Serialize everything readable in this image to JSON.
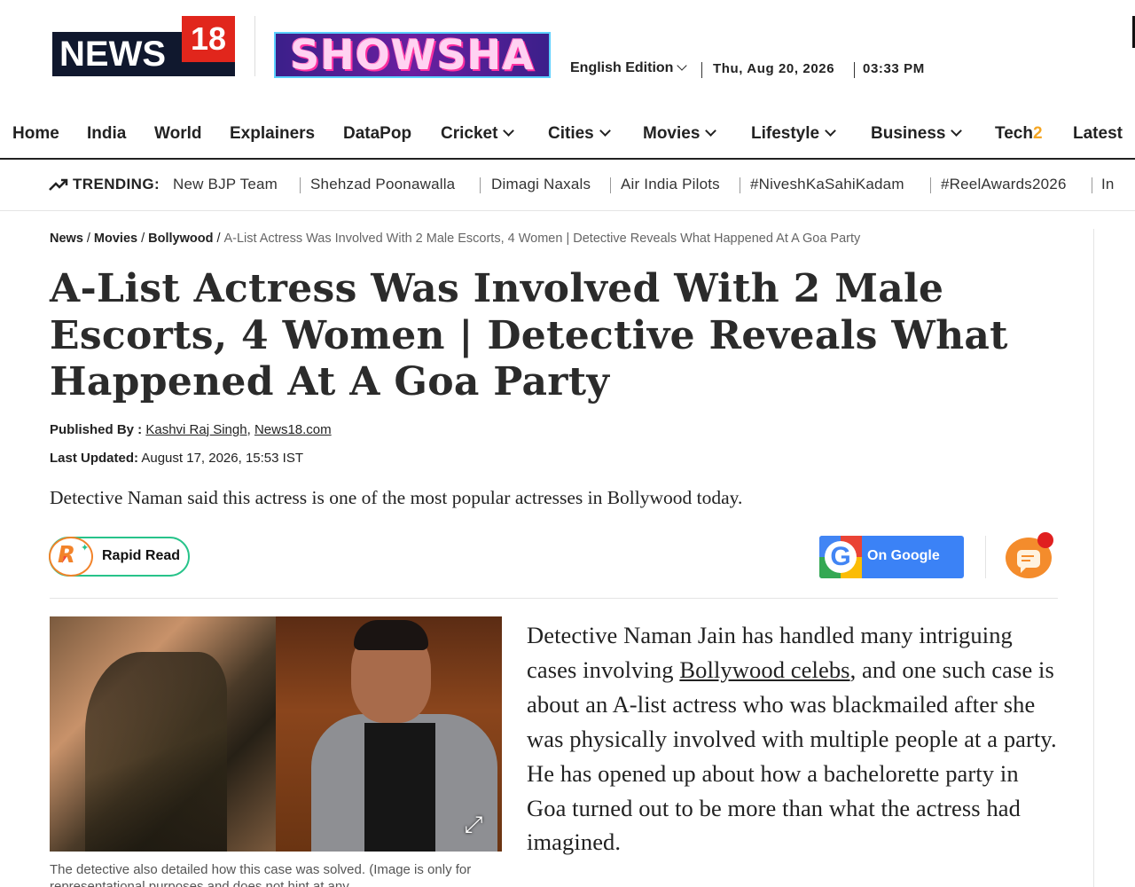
{
  "header": {
    "logo_news": "NEWS",
    "logo_eighteen": "18",
    "logo_showsha": "SHOWSHA",
    "edition": "English Edition",
    "date": "Thu, Aug 20, 2026",
    "time": "03:33 PM"
  },
  "nav": {
    "items": [
      "Home",
      "India",
      "World",
      "Explainers",
      "DataPop",
      "Cricket",
      "Cities",
      "Movies",
      "Lifestyle",
      "Business",
      "Tech",
      "Latest"
    ],
    "tech_suffix": "2"
  },
  "trending": {
    "label": "TRENDING:",
    "items": [
      "New BJP Team",
      "Shehzad Poonawalla",
      "Dimagi Naxals",
      "Air India Pilots",
      "#NiveshKaSahiKadam",
      "#ReelAwards2026",
      "In"
    ]
  },
  "breadcrumb": {
    "news": "News",
    "movies": "Movies",
    "bollywood": "Bollywood",
    "separator": "/",
    "current": "A-List Actress Was Involved With 2 Male Escorts, 4 Women | Detective Reveals What Happened At A Goa Party"
  },
  "article": {
    "headline": "A-List Actress Was Involved With 2 Male Escorts, 4 Women | Detective Reveals What Happened At A Goa Party",
    "published_label": "Published By :",
    "author": "Kashvi Raj Singh",
    "outlet": "News18.com",
    "updated_label": "Last Updated:",
    "updated_value": "August 17, 2026, 15:53 IST",
    "summary": "Detective Naman said this actress is one of the most popular actresses in Bollywood today.",
    "rapid_read": "Rapid Read",
    "on_google": "On Google",
    "caption": "The detective also detailed how this case was solved. (Image is only for representational purposes and does not hint at any",
    "body_before_link": "Detective Naman Jain has handled many intriguing cases involving ",
    "body_link": "Bollywood celebs",
    "body_after_link": ", and one such case is about an A-list actress who was blackmailed after she was physically involved with multiple people at a party. He has opened up about how a bachelorette party in Goa turned out to be more than what the actress had imagined."
  },
  "colors": {
    "news18_red": "#e1261c",
    "news18_navy": "#10182e",
    "google_blue": "#3b82f6",
    "rapid_green": "#27c38a",
    "accent_orange": "#f48c2c"
  },
  "icons": [
    "trending-icon",
    "chevron-down-icon",
    "rapid-read-icon",
    "google-icon",
    "comment-icon",
    "expand-icon"
  ]
}
